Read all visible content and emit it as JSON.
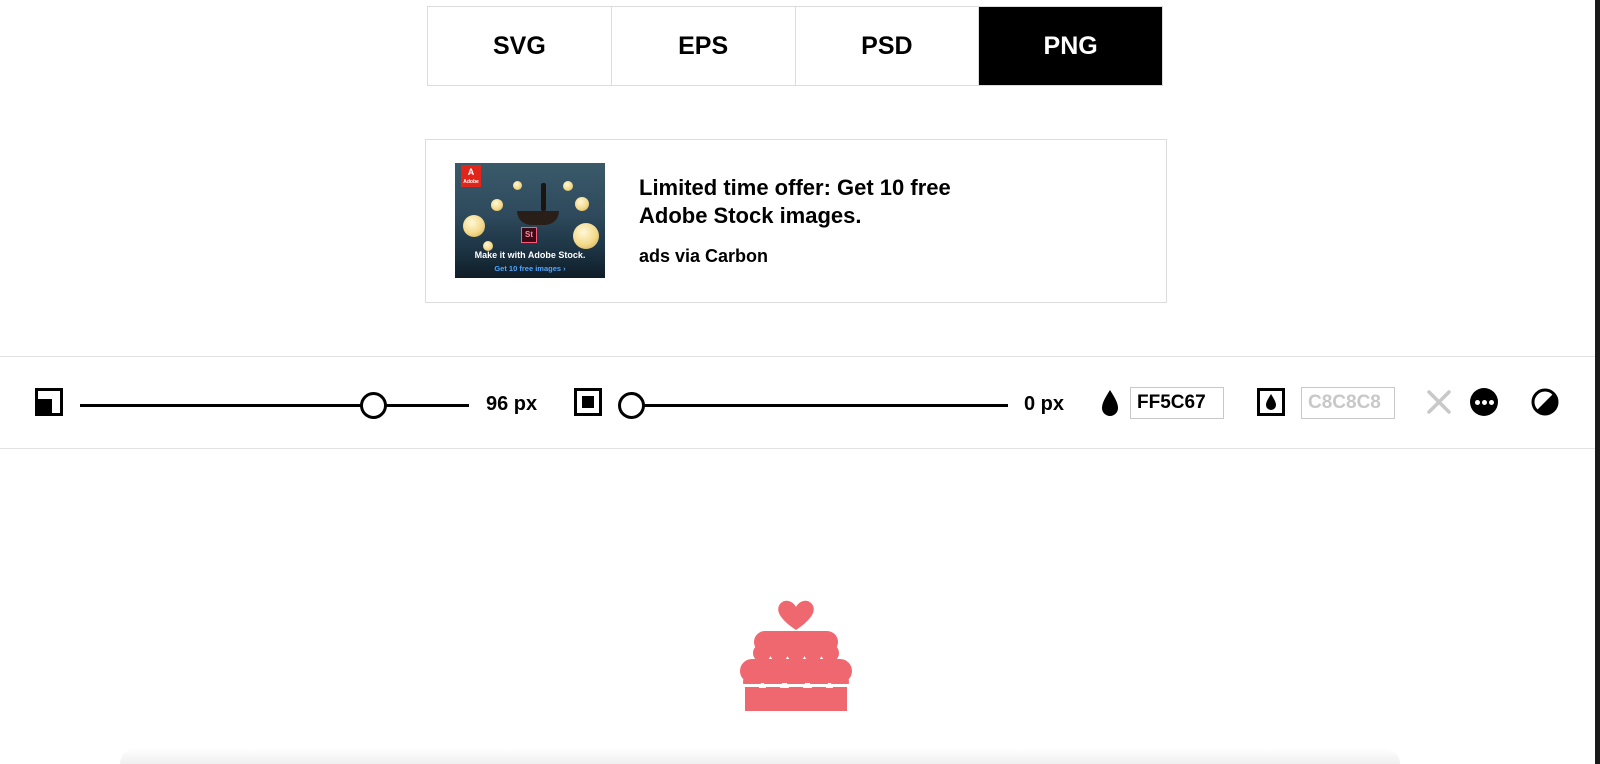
{
  "format_tabs": [
    {
      "label": "SVG",
      "active": false
    },
    {
      "label": "EPS",
      "active": false
    },
    {
      "label": "PSD",
      "active": false
    },
    {
      "label": "PNG",
      "active": true
    }
  ],
  "ad": {
    "title": "Limited time offer: Get 10 free Adobe Stock images.",
    "via": "ads via Carbon",
    "image_caption": "Make it with Adobe Stock.",
    "image_subcaption": "Get 10 free images ›",
    "image_logo": "Adobe",
    "image_badge": "St"
  },
  "toolbar": {
    "size_value": 96,
    "size_label": "96 px",
    "padding_value": 0,
    "padding_label": "0 px",
    "icon_color": "FF5C67",
    "background_color": "C8C8C8"
  },
  "preview": {
    "icon_name": "cake-icon",
    "color": "#f0686f"
  }
}
